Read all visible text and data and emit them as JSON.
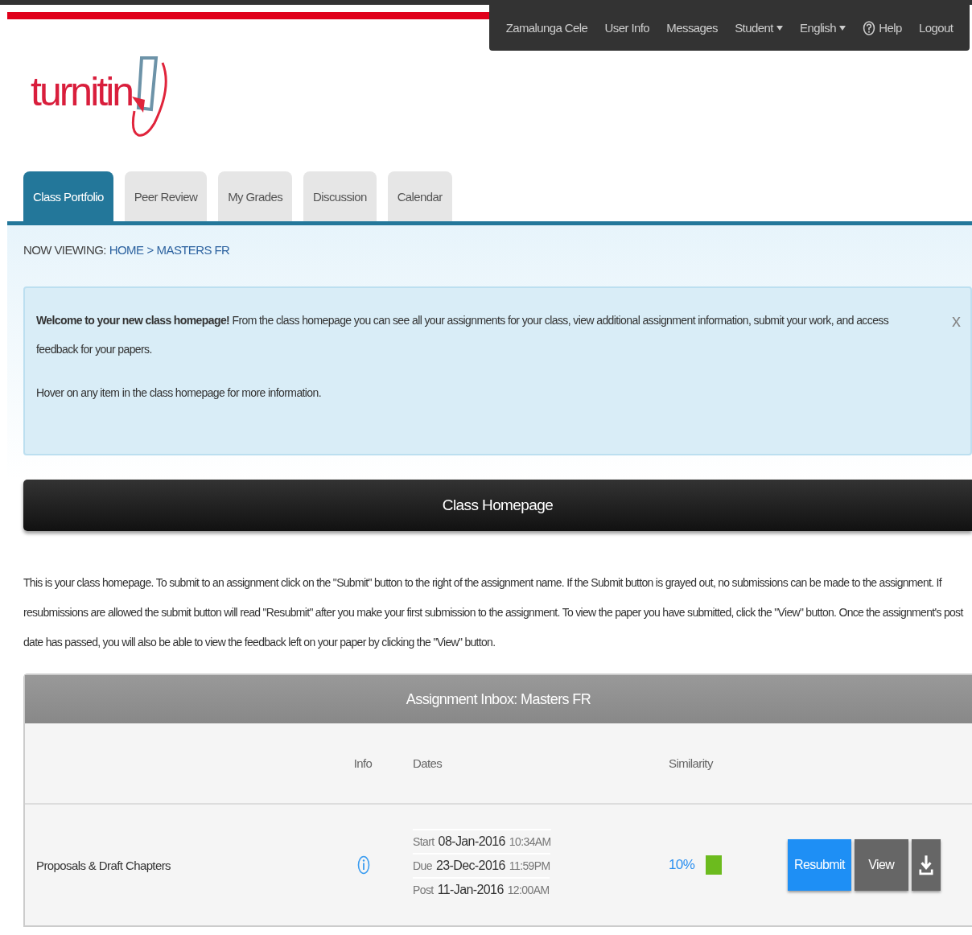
{
  "top_menu": [
    {
      "label": "Zamalunga Cele",
      "kind": "plain"
    },
    {
      "label": "User Info",
      "kind": "plain"
    },
    {
      "label": "Messages",
      "kind": "plain"
    },
    {
      "label": "Student",
      "kind": "dropdown"
    },
    {
      "label": "English",
      "kind": "dropdown"
    },
    {
      "label": "Help",
      "kind": "help"
    },
    {
      "label": "Logout",
      "kind": "plain"
    }
  ],
  "logo": {
    "text": "turnitin"
  },
  "tabs": [
    {
      "label": "Class Portfolio",
      "selected": true
    },
    {
      "label": "Peer Review",
      "selected": false
    },
    {
      "label": "My Grades",
      "selected": false
    },
    {
      "label": "Discussion",
      "selected": false
    },
    {
      "label": "Calendar",
      "selected": false
    }
  ],
  "breadcrumb": {
    "prefix": "NOW VIEWING:",
    "items": [
      "HOME",
      "MASTERS FR"
    ],
    "separator": ">"
  },
  "welcome": {
    "paragraphs": [
      "**Welcome to your new class homepage!** From the class homepage you can see all your assignments for your class, view additional assignment information, submit your work, and access feedback for your papers.",
      "Hover on any item in the class homepage for more information."
    ],
    "close": "x"
  },
  "header": {
    "title": "Class Homepage"
  },
  "intro": "This is your class homepage. To submit to an assignment click on the \"Submit\" button to the right of the assignment name. If the Submit button is grayed out, no submissions can be made to the assignment. If resubmissions are allowed the submit button will read \"Resubmit\" after you make your first submission to the assignment. To view the paper you have submitted, click the \"View\" button. Once the assignment's post date has passed, you will also be able to view the feedback left on your paper by clicking the \"View\" button.",
  "inbox": {
    "title": "Assignment Inbox: Masters FR",
    "columns": [
      "Info",
      "Dates",
      "Similarity"
    ],
    "rows": [
      {
        "name": "Proposals & Draft Chapters",
        "dates": [
          {
            "label": "Start",
            "date": "08-Jan-2016",
            "time": "10:34AM"
          },
          {
            "label": "Due",
            "date": "23-Dec-2016",
            "time": "11:59PM"
          },
          {
            "label": "Post",
            "date": "11-Jan-2016",
            "time": "12:00AM"
          }
        ],
        "similarity": "10%",
        "color": "#6cbb1e",
        "buttons": [
          "Resubmit",
          "View"
        ]
      }
    ]
  }
}
